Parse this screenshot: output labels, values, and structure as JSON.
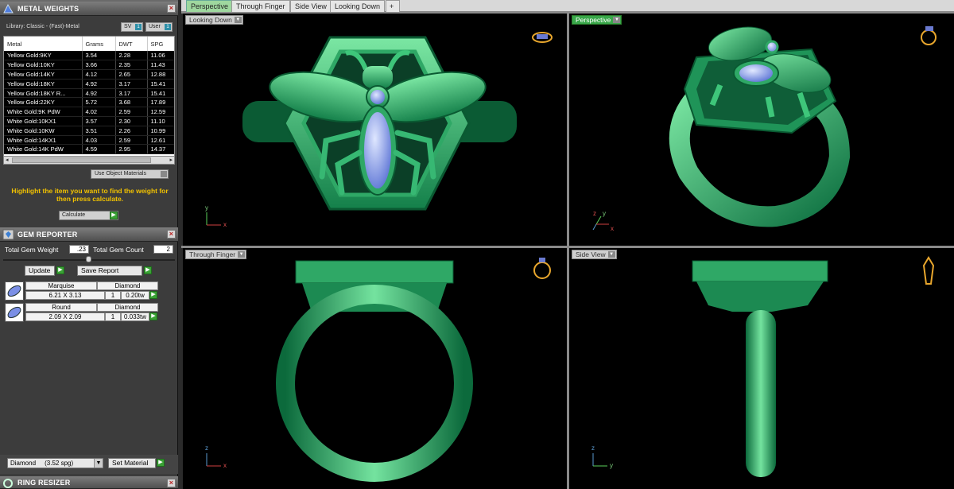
{
  "panels": {
    "metal_weights": {
      "title": "METAL WEIGHTS",
      "library": "Library: Classic - (Fast)-Metal",
      "toggle_left": "SV",
      "toggle_left_value": "1",
      "toggle_right": "User",
      "toggle_right_value": "1",
      "columns": [
        "Metal",
        "Grams",
        "DWT",
        "SPG"
      ],
      "rows": [
        [
          "Yellow Gold:9KY",
          "3.54",
          "2.28",
          "11.06"
        ],
        [
          "Yellow Gold:10KY",
          "3.66",
          "2.35",
          "11.43"
        ],
        [
          "Yellow Gold:14KY",
          "4.12",
          "2.65",
          "12.88"
        ],
        [
          "Yellow Gold:18KY",
          "4.92",
          "3.17",
          "15.41"
        ],
        [
          "Yellow Gold:18KY R...",
          "4.92",
          "3.17",
          "15.41"
        ],
        [
          "Yellow Gold:22KY",
          "5.72",
          "3.68",
          "17.89"
        ],
        [
          "White Gold:9K PdW",
          "4.02",
          "2.59",
          "12.59"
        ],
        [
          "White Gold:10KX1",
          "3.57",
          "2.30",
          "11.10"
        ],
        [
          "White Gold:10KW",
          "3.51",
          "2.26",
          "10.99"
        ],
        [
          "White Gold:14KX1",
          "4.03",
          "2.59",
          "12.61"
        ],
        [
          "White Gold:14K PdW",
          "4.59",
          "2.95",
          "14.37"
        ]
      ],
      "use_object_materials": "Use Object Materials",
      "hint": "Highlight the item you want to find the weight for then press calculate.",
      "calculate": "Calculate"
    },
    "gem_reporter": {
      "title": "GEM REPORTER",
      "total_weight_label": "Total Gem Weight",
      "total_weight_value": ".23",
      "total_count_label": "Total Gem Count",
      "total_count_value": "2",
      "update": "Update",
      "save_report": "Save Report",
      "gems": [
        {
          "shape": "Marquise",
          "size": "6.21 X 3.13",
          "qty": "1",
          "material": "Diamond",
          "weight": "0.20tw"
        },
        {
          "shape": "Round",
          "size": "2.09 X 2.09",
          "qty": "1",
          "material": "Diamond",
          "weight": "0.033tw"
        }
      ],
      "material_select": "Diamond     (3.52 spg)",
      "set_material": "Set Material"
    },
    "ring_resizer": {
      "title": "RING RESIZER"
    }
  },
  "tabs": [
    "Perspective",
    "Through Finger",
    "Side View",
    "Looking Down",
    "+"
  ],
  "viewports": {
    "top_left": "Looking Down",
    "top_right": "Perspective",
    "bottom_left": "Through Finger",
    "bottom_right": "Side View"
  },
  "axes": {
    "x": "x",
    "y": "y",
    "z": "z"
  },
  "colors": {
    "model_green": "#2fa866",
    "gem_blue": "#8fa4f2",
    "label_yellow": "#f2c200",
    "active_tab": "#9fd89f"
  }
}
